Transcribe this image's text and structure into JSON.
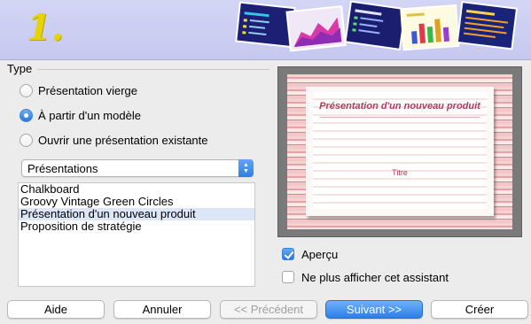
{
  "banner": {
    "step_number": "1.",
    "thumbnails": [
      "bullets-slide-icon",
      "area-chart-slide-icon",
      "list-slide-icon",
      "bar-chart-slide-icon",
      "text-lines-slide-icon"
    ]
  },
  "type_section": {
    "label": "Type",
    "options": [
      {
        "label": "Présentation vierge",
        "selected": false
      },
      {
        "label": "À partir d'un modèle",
        "selected": true
      },
      {
        "label": "Ouvrir une présentation existante",
        "selected": false
      }
    ]
  },
  "category_select": {
    "value": "Présentations"
  },
  "template_list": {
    "items": [
      "Chalkboard",
      "Groovy Vintage Green Circles",
      "Présentation d'un nouveau produit",
      "Proposition de stratégie"
    ],
    "selected_index": 2
  },
  "preview": {
    "slide_title": "Présentation d'un nouveau produit",
    "slide_subtitle": "Titre"
  },
  "checkboxes": {
    "preview": {
      "label": "Aperçu",
      "checked": true
    },
    "dont_show": {
      "label": "Ne plus afficher cet assistant",
      "checked": false
    }
  },
  "buttons": {
    "help": "Aide",
    "cancel": "Annuler",
    "previous": "<< Précédent",
    "next": "Suivant >>",
    "create": "Créer"
  },
  "colors": {
    "accent": "#2c7fe8",
    "banner": "#c6c8ef",
    "step_number": "#e6d400",
    "slide_title": "#b33a5c"
  }
}
